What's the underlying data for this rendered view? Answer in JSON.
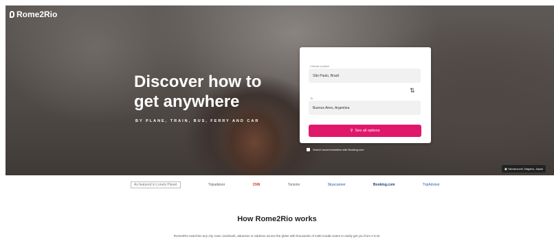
{
  "brand": {
    "name": "Rome2Rio"
  },
  "hero": {
    "headline": "Discover how to get anywhere",
    "subheadline": "BY PLANE, TRAIN, BUS, FERRY AND CAR",
    "photo_credit": "Yamanouchi, Nagano, Japan"
  },
  "search": {
    "from_label": "Choose a place",
    "from_value": "São Paulo, Brazil",
    "to_label": "To",
    "to_value": "Buenos Aires, Argentina",
    "button_label": "See all options",
    "accommodation_label": "Search accommodation with Booking.com"
  },
  "partners": [
    "As featured in Lonely Planet",
    "Tripadvisor",
    "CNN",
    "Turismo",
    "Skyscanner",
    "Booking.com",
    "TripAdvisor"
  ],
  "how_it_works": {
    "title": "How Rome2Rio works",
    "description": "Rome2Rio searches any city, town, landmark, attraction or address across the globe with thousands of multi-modal routes to easily get you from A to B."
  }
}
